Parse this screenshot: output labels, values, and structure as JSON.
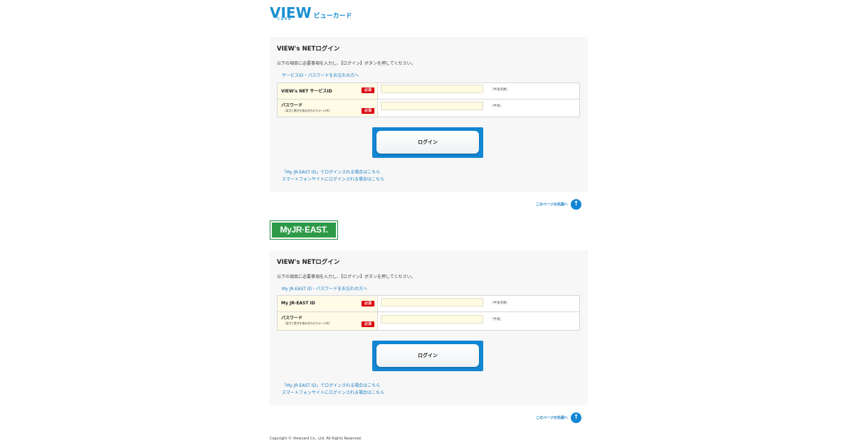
{
  "header": {
    "logo_text": "VIEW",
    "logo_sub": "CARD",
    "logo_kana": "ビューカード"
  },
  "sections": [
    {
      "title": "VIEW's NETログイン",
      "intro": "以下の項目に必要事項を入力し、【ログイン】ボタンを押してください。",
      "forgot_link": "サービスID・パスワードをお忘れの方へ",
      "fields": [
        {
          "label": "VIEW's NET サービスID",
          "sublabel": "",
          "required": "必須",
          "value": "",
          "hint": "［半角英数］"
        },
        {
          "label": "パスワード",
          "sublabel": "（英字と数字を組み合わせた8～12桁）",
          "required": "必須",
          "value": "",
          "hint": "［半角］"
        }
      ],
      "login_label": "ログイン",
      "alt_links": [
        "「My JR-EAST ID」でログインされる場合はこちら",
        "スマートフォンサイトにログインされる場合はこちら"
      ],
      "to_top": "このページの先頭へ"
    },
    {
      "brand": "MyJR·EAST.",
      "title": "VIEW's NETログイン",
      "intro": "以下の項目に必要事項を入力し、【ログイン】ボタンを押してください。",
      "forgot_link": "My JR-EAST ID・パスワードをお忘れの方へ",
      "fields": [
        {
          "label": "My JR-EAST ID",
          "sublabel": "",
          "required": "必須",
          "value": "",
          "hint": "［半角英数］"
        },
        {
          "label": "パスワード",
          "sublabel": "（英字と数字を組み合わせた8～12桁）",
          "required": "必須",
          "value": "",
          "hint": "［半角］"
        }
      ],
      "login_label": "ログイン",
      "alt_links": [
        "「My JR-EAST ID」でログインされる場合はこちら",
        "スマートフォンサイトにログインされる場合はこちら"
      ],
      "to_top": "このページの先頭へ"
    }
  ],
  "footer": {
    "copyright": "Copyright © Viewcard Co., Ltd. All Rights Reserved."
  },
  "colors": {
    "accent": "#1386d3",
    "link": "#1a7ec2",
    "required": "#d9000d",
    "myjr_green": "#2e9a47"
  }
}
